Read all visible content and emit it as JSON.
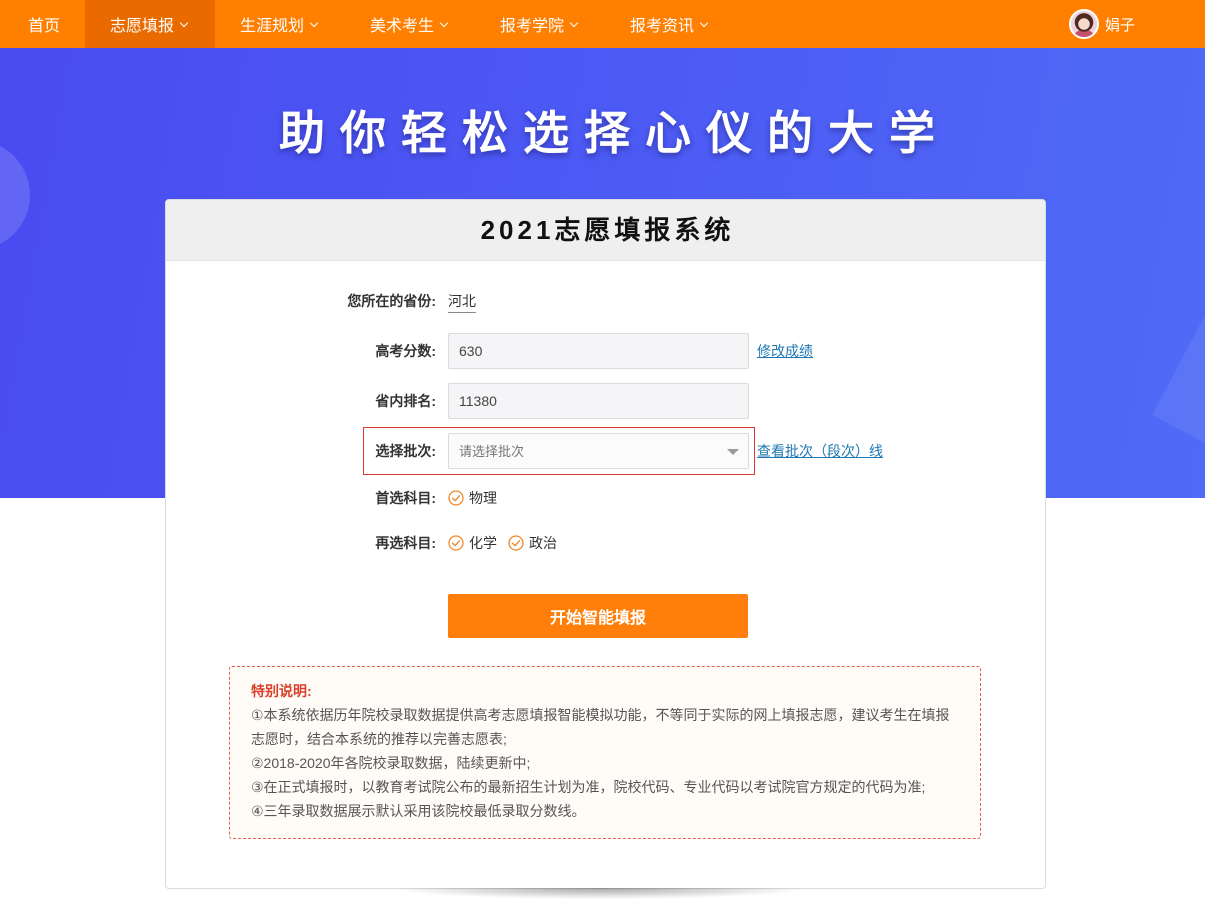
{
  "nav": {
    "items": [
      {
        "label": "首页",
        "dropdown": false,
        "active": false
      },
      {
        "label": "志愿填报",
        "dropdown": true,
        "active": true,
        "icon": "chevron-down-icon"
      },
      {
        "label": "生涯规划",
        "dropdown": true,
        "active": false,
        "icon": "chevron-down-icon"
      },
      {
        "label": "美术考生",
        "dropdown": true,
        "active": false,
        "icon": "chevron-down-icon"
      },
      {
        "label": "报考学院",
        "dropdown": true,
        "active": false,
        "icon": "chevron-down-icon"
      },
      {
        "label": "报考资讯",
        "dropdown": true,
        "active": false,
        "icon": "chevron-down-icon"
      }
    ],
    "user": {
      "name": "娟子",
      "icon": "avatar"
    }
  },
  "hero": {
    "title": "助你轻松选择心仪的大学"
  },
  "card": {
    "title": "2021志愿填报系统",
    "province": {
      "label": "您所在的省份:",
      "value": "河北"
    },
    "score": {
      "label": "高考分数:",
      "value": "630",
      "link": "修改成绩"
    },
    "rank": {
      "label": "省内排名:",
      "value": "11380"
    },
    "batch": {
      "label": "选择批次:",
      "placeholder": "请选择批次",
      "link": "查看批次（段次）线",
      "icon": "caret-down-icon"
    },
    "first_subject": {
      "label": "首选科目:",
      "options": [
        {
          "name": "物理",
          "checked": true
        }
      ]
    },
    "second_subject": {
      "label": "再选科目:",
      "options": [
        {
          "name": "化学",
          "checked": true
        },
        {
          "name": "政治",
          "checked": true
        }
      ]
    },
    "check_icon": "check-circle-icon",
    "submit_label": "开始智能填报",
    "notice": {
      "title": "特别说明:",
      "items": [
        "①本系统依据历年院校录取数据提供高考志愿填报智能模拟功能，不等同于实际的网上填报志愿，建议考生在填报志愿时，结合本系统的推荐以完善志愿表;",
        "②2018-2020年各院校录取数据，陆续更新中;",
        "③在正式填报时，以教育考试院公布的最新招生计划为准，院校代码、专业代码以考试院官方规定的代码为准;",
        "④三年录取数据展示默认采用该院校最低录取分数线。"
      ]
    }
  },
  "colors": {
    "accent": "#ff7f00",
    "nav_active": "#e96b00",
    "hero_blue": "#4b58f4",
    "link": "#1e78b4",
    "alert_red": "#d8402b",
    "check_orange": "#f0892a"
  }
}
